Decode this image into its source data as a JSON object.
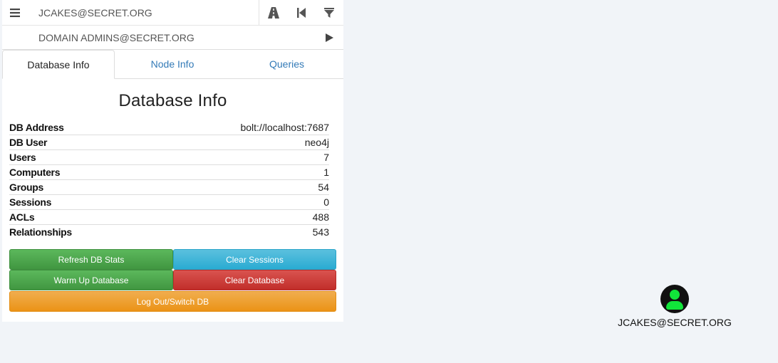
{
  "search": {
    "start_node": "JCAKES@SECRET.ORG",
    "end_node": "DOMAIN ADMINS@SECRET.ORG"
  },
  "icons": {
    "menu": "hamburger-menu-icon",
    "pathfinding": "road-icon",
    "back": "step-backward-icon",
    "filter": "filter-icon",
    "play": "play-icon",
    "user": "user-avatar-icon"
  },
  "tabs": [
    {
      "label": "Database Info",
      "active": true
    },
    {
      "label": "Node Info",
      "active": false
    },
    {
      "label": "Queries",
      "active": false
    }
  ],
  "db_info": {
    "title": "Database Info",
    "stats": [
      {
        "label": "DB Address",
        "value": "bolt://localhost:7687"
      },
      {
        "label": "DB User",
        "value": "neo4j"
      },
      {
        "label": "Users",
        "value": "7"
      },
      {
        "label": "Computers",
        "value": "1"
      },
      {
        "label": "Groups",
        "value": "54"
      },
      {
        "label": "Sessions",
        "value": "0"
      },
      {
        "label": "ACLs",
        "value": "488"
      },
      {
        "label": "Relationships",
        "value": "543"
      }
    ]
  },
  "buttons": {
    "refresh": "Refresh DB Stats",
    "clear_sessions": "Clear Sessions",
    "warm_up": "Warm Up Database",
    "clear_database": "Clear Database",
    "logout": "Log Out/Switch DB"
  },
  "user": {
    "name": "JCAKES@SECRET.ORG",
    "avatar_color": "#11e53a"
  },
  "colors": {
    "tab_link": "#337ab7",
    "success": "#5cb85c",
    "info": "#5bc0de",
    "danger": "#d9534f",
    "warning": "#f0ad4e"
  }
}
